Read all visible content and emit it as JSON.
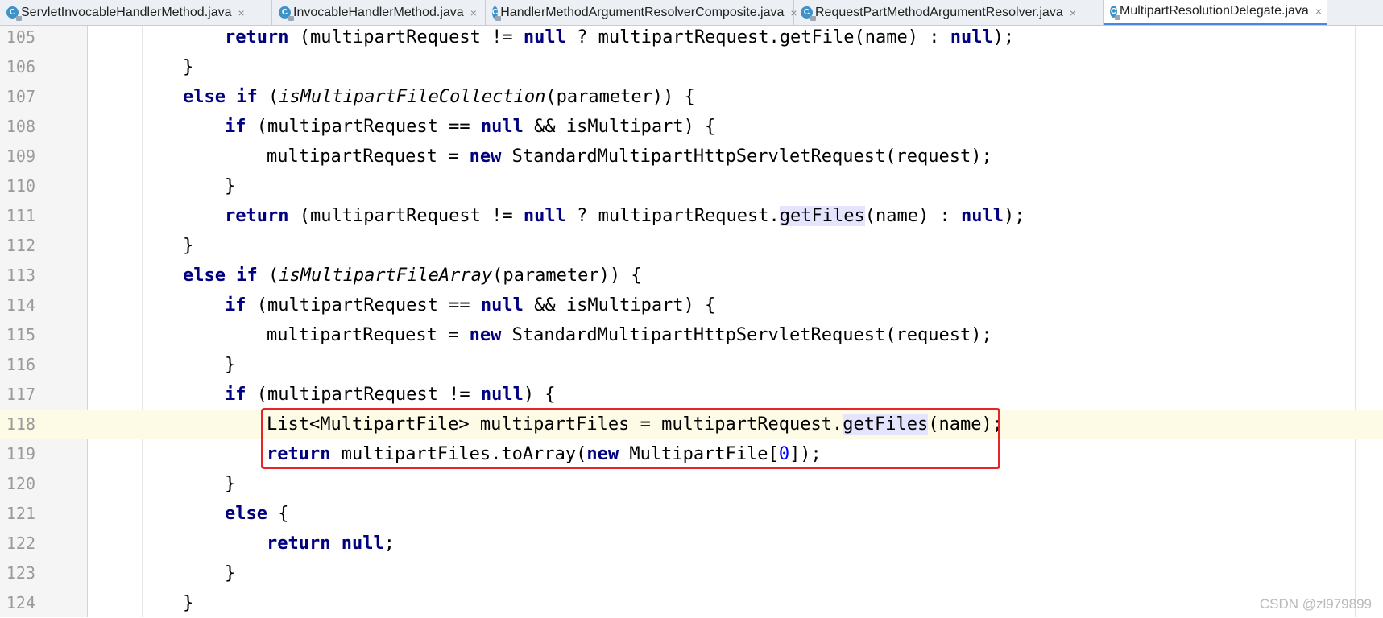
{
  "tabs": [
    {
      "label": "ServletInvocableHandlerMethod.java",
      "icon": "java-class-icon",
      "active": false
    },
    {
      "label": "InvocableHandlerMethod.java",
      "icon": "java-class-icon",
      "active": false
    },
    {
      "label": "HandlerMethodArgumentResolverComposite.java",
      "icon": "java-class-icon",
      "active": false
    },
    {
      "label": "RequestPartMethodArgumentResolver.java",
      "icon": "java-class-icon",
      "active": false
    },
    {
      "label": "MultipartResolutionDelegate.java",
      "icon": "java-class-icon",
      "active": true
    }
  ],
  "tab_icon_letter": "C",
  "tab_close_glyph": "×",
  "lines": [
    {
      "num": "105",
      "indent": 3,
      "tokens": [
        [
          "kw",
          "return"
        ],
        [
          "t",
          " (multipartRequest != "
        ],
        [
          "kw",
          "null"
        ],
        [
          "t",
          " ? multipartRequest.getFile(name) : "
        ],
        [
          "kw",
          "null"
        ],
        [
          "t",
          ");"
        ]
      ]
    },
    {
      "num": "106",
      "indent": 2,
      "tokens": [
        [
          "t",
          "}"
        ]
      ]
    },
    {
      "num": "107",
      "indent": 2,
      "tokens": [
        [
          "kw",
          "else if"
        ],
        [
          "t",
          " ("
        ],
        [
          "it",
          "isMultipartFileCollection"
        ],
        [
          "t",
          "(parameter)) {"
        ]
      ]
    },
    {
      "num": "108",
      "indent": 3,
      "tokens": [
        [
          "kw",
          "if"
        ],
        [
          "t",
          " (multipartRequest == "
        ],
        [
          "kw",
          "null"
        ],
        [
          "t",
          " && isMultipart) {"
        ]
      ]
    },
    {
      "num": "109",
      "indent": 4,
      "tokens": [
        [
          "t",
          "multipartRequest = "
        ],
        [
          "kw",
          "new"
        ],
        [
          "t",
          " StandardMultipartHttpServletRequest(request);"
        ]
      ]
    },
    {
      "num": "110",
      "indent": 3,
      "tokens": [
        [
          "t",
          "}"
        ]
      ]
    },
    {
      "num": "111",
      "indent": 3,
      "tokens": [
        [
          "kw",
          "return"
        ],
        [
          "t",
          " (multipartRequest != "
        ],
        [
          "kw",
          "null"
        ],
        [
          "t",
          " ? multipartRequest."
        ],
        [
          "hl",
          "getFiles"
        ],
        [
          "t",
          "(name) : "
        ],
        [
          "kw",
          "null"
        ],
        [
          "t",
          ");"
        ]
      ]
    },
    {
      "num": "112",
      "indent": 2,
      "tokens": [
        [
          "t",
          "}"
        ]
      ]
    },
    {
      "num": "113",
      "indent": 2,
      "tokens": [
        [
          "kw",
          "else if"
        ],
        [
          "t",
          " ("
        ],
        [
          "it",
          "isMultipartFileArray"
        ],
        [
          "t",
          "(parameter)) {"
        ]
      ]
    },
    {
      "num": "114",
      "indent": 3,
      "tokens": [
        [
          "kw",
          "if"
        ],
        [
          "t",
          " (multipartRequest == "
        ],
        [
          "kw",
          "null"
        ],
        [
          "t",
          " && isMultipart) {"
        ]
      ]
    },
    {
      "num": "115",
      "indent": 4,
      "tokens": [
        [
          "t",
          "multipartRequest = "
        ],
        [
          "kw",
          "new"
        ],
        [
          "t",
          " StandardMultipartHttpServletRequest(request);"
        ]
      ]
    },
    {
      "num": "116",
      "indent": 3,
      "tokens": [
        [
          "t",
          "}"
        ]
      ]
    },
    {
      "num": "117",
      "indent": 3,
      "tokens": [
        [
          "kw",
          "if"
        ],
        [
          "t",
          " (multipartRequest != "
        ],
        [
          "kw",
          "null"
        ],
        [
          "t",
          ") {"
        ]
      ]
    },
    {
      "num": "118",
      "indent": 4,
      "current": true,
      "tokens": [
        [
          "t",
          "List<MultipartFile> multipartFiles = multipartRequest."
        ],
        [
          "hl",
          "getFiles"
        ],
        [
          "t",
          "(name);"
        ]
      ]
    },
    {
      "num": "119",
      "indent": 4,
      "tokens": [
        [
          "kw",
          "return"
        ],
        [
          "t",
          " multipartFiles.toArray("
        ],
        [
          "kw",
          "new"
        ],
        [
          "t",
          " MultipartFile["
        ],
        [
          "num",
          "0"
        ],
        [
          "t",
          "]);"
        ]
      ]
    },
    {
      "num": "120",
      "indent": 3,
      "tokens": [
        [
          "t",
          "}"
        ]
      ]
    },
    {
      "num": "121",
      "indent": 3,
      "tokens": [
        [
          "kw",
          "else"
        ],
        [
          "t",
          " {"
        ]
      ]
    },
    {
      "num": "122",
      "indent": 4,
      "tokens": [
        [
          "kw",
          "return null"
        ],
        [
          "t",
          ";"
        ]
      ]
    },
    {
      "num": "123",
      "indent": 3,
      "tokens": [
        [
          "t",
          "}"
        ]
      ]
    },
    {
      "num": "124",
      "indent": 2,
      "tokens": [
        [
          "t",
          "}"
        ]
      ]
    }
  ],
  "watermark": "CSDN @zl979899",
  "colors": {
    "keyword": "#000080",
    "number": "#0000ff",
    "current_line": "#fdfbe6",
    "usage_highlight": "#e4e4ff",
    "annotation_box": "#e8232a"
  }
}
